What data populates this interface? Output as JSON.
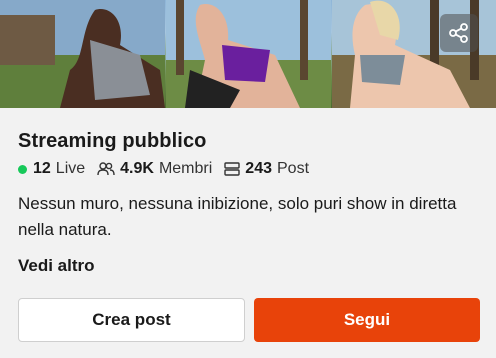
{
  "group": {
    "title": "Streaming pubblico",
    "description": "Nessun muro, nessuna inibizione, solo puri show in diretta nella natura."
  },
  "stats": {
    "live_count": "12",
    "live_label": "Live",
    "members_count": "4.9K",
    "members_label": "Membri",
    "posts_count": "243",
    "posts_label": "Post"
  },
  "actions": {
    "see_more": "Vedi altro",
    "create_post": "Crea post",
    "follow": "Segui"
  },
  "colors": {
    "accent": "#e8430a",
    "live_dot": "#17c95a"
  },
  "icons": {
    "share": "share-icon",
    "members": "members-icon",
    "posts": "posts-icon"
  }
}
